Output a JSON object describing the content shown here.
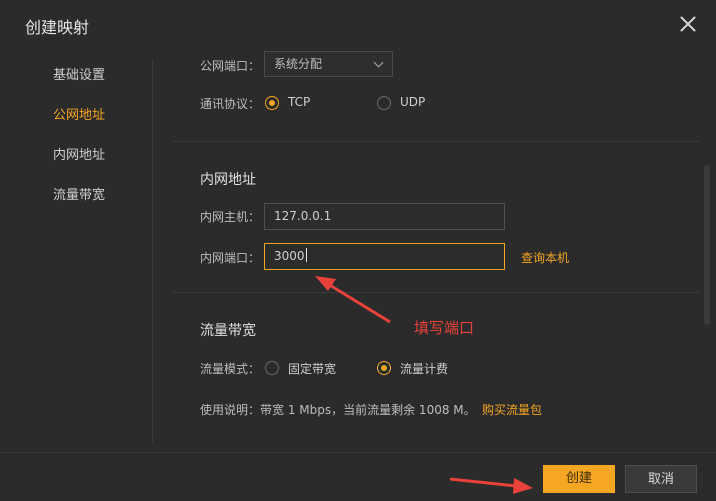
{
  "dialog": {
    "title": "创建映射"
  },
  "sidebar": {
    "items": [
      {
        "label": "基础设置",
        "active": false
      },
      {
        "label": "公网地址",
        "active": true
      },
      {
        "label": "内网地址",
        "active": false
      },
      {
        "label": "流量带宽",
        "active": false
      }
    ]
  },
  "public": {
    "port_label": "公网端口：",
    "port_value": "系统分配",
    "protocol_label": "通讯协议：",
    "protocols": [
      {
        "label": "TCP",
        "selected": true
      },
      {
        "label": "UDP",
        "selected": false
      }
    ]
  },
  "internal": {
    "title": "内网地址",
    "host_label": "内网主机：",
    "host_value": "127.0.0.1",
    "port_label": "内网端口：",
    "port_value": "3000",
    "query_link": "查询本机"
  },
  "bandwidth": {
    "title": "流量带宽",
    "mode_label": "流量模式：",
    "modes": [
      {
        "label": "固定带宽",
        "selected": false
      },
      {
        "label": "流量计费",
        "selected": true
      }
    ],
    "usage_prefix": "使用说明：",
    "usage_text": "带宽 1 Mbps，当前流量剩余 1008 M。",
    "buy_link": "购买流量包"
  },
  "annotation": {
    "text": "填写端口"
  },
  "footer": {
    "create": "创建",
    "cancel": "取消"
  },
  "colors": {
    "accent": "#f5a623",
    "annotation": "#e8423a",
    "background": "#2b2b2b"
  }
}
